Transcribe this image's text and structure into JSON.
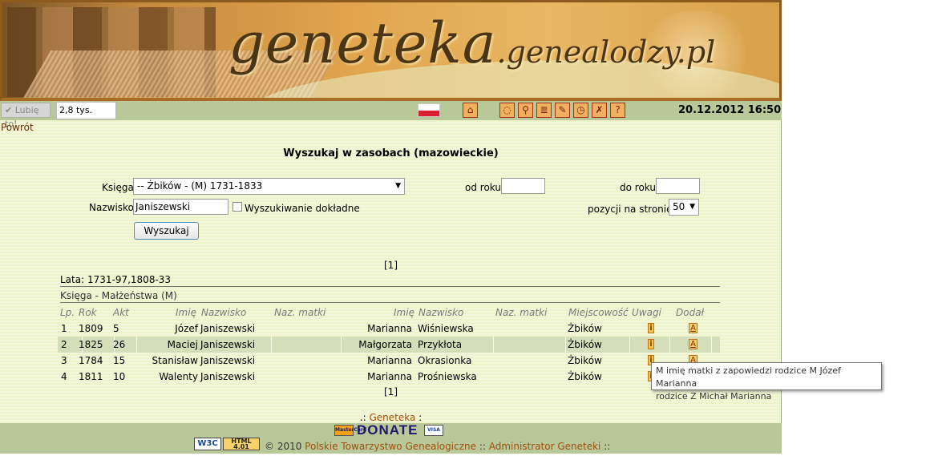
{
  "banner": {
    "logo_main": "geneteka",
    "logo_domain": ".genealodzy.pl"
  },
  "toolbar": {
    "like_label": "✔ Lubię to!",
    "like_count": "2,8 tys.",
    "datetime": "20.12.2012 16:50",
    "icons": [
      "home-icon",
      "map-icon",
      "search-icon",
      "list-icon",
      "edit-icon",
      "clock-icon",
      "tools-icon",
      "help-icon"
    ]
  },
  "nav": {
    "back": "Powrót"
  },
  "search": {
    "title": "Wyszukaj w zasobach (mazowieckie)",
    "book_label": "Księga",
    "book_value": "-- Żbików - (M) 1731-1833",
    "from_year_label": "od roku",
    "from_year_value": "",
    "to_year_label": "do roku",
    "to_year_value": "",
    "surname_label": "Nazwisko",
    "surname_value": "Janiszewski",
    "exact_label": "Wyszukiwanie dokładne",
    "per_page_label": "pozycji na stronie",
    "per_page_value": "50",
    "submit": "Wyszukaj"
  },
  "results": {
    "pager_top": "[1]",
    "pager_bottom": "[1]",
    "years": "Lata: 1731-97,1808-33",
    "book": "Księga - Małżeństwa (M)",
    "headers": {
      "lp": "Lp.",
      "rok": "Rok",
      "akt": "Akt",
      "imie1": "Imię",
      "nazwisko1": "Nazwisko",
      "matka1": "Naz. matki",
      "imie2": "Imię",
      "nazwisko2": "Nazwisko",
      "matka2": "Naz. matki",
      "miejscowosc": "Miejscowość",
      "uwagi": "Uwagi",
      "dodal": "Dodał"
    },
    "rows": [
      {
        "lp": "1",
        "rok": "1809",
        "akt": "5",
        "imie1": "Józef",
        "nazwisko1": "Janiszewski",
        "imie2": "Marianna",
        "nazwisko2": "Wiśniewska",
        "miejscowosc": "Żbików"
      },
      {
        "lp": "2",
        "rok": "1825",
        "akt": "26",
        "imie1": "Maciej",
        "nazwisko1": "Janiszewski",
        "imie2": "Małgorzata",
        "nazwisko2": "Przykłota",
        "miejscowosc": "Żbików"
      },
      {
        "lp": "3",
        "rok": "1784",
        "akt": "15",
        "imie1": "Stanisław",
        "nazwisko1": "Janiszewski",
        "imie2": "Marianna",
        "nazwisko2": "Okrasionka",
        "miejscowosc": "Żbików"
      },
      {
        "lp": "4",
        "rok": "1811",
        "akt": "10",
        "imie1": "Walenty",
        "nazwisko1": "Janiszewski",
        "imie2": "Marianna",
        "nazwisko2": "Prośniewska",
        "miejscowosc": "Żbików"
      }
    ],
    "tooltip_line1": "M imię matki z zapowiedzi rodzice M Józef Marianna",
    "tooltip_line2": "rodzice Z Michał Marianna"
  },
  "footer": {
    "prefix": ".: ",
    "geneteka": "Geneteka",
    "suffix": " :",
    "donate": "DONATE",
    "copyright": "© 2010 ",
    "ptg": "Polskie Towarzystwo Genealogiczne",
    "sep": " :: ",
    "admin": "Administrator Geneteki",
    "end": " ::",
    "w3c": "W3C",
    "html_badge": "HTML 4.01",
    "mastercard": "MasterCard",
    "visa": "VISA"
  }
}
